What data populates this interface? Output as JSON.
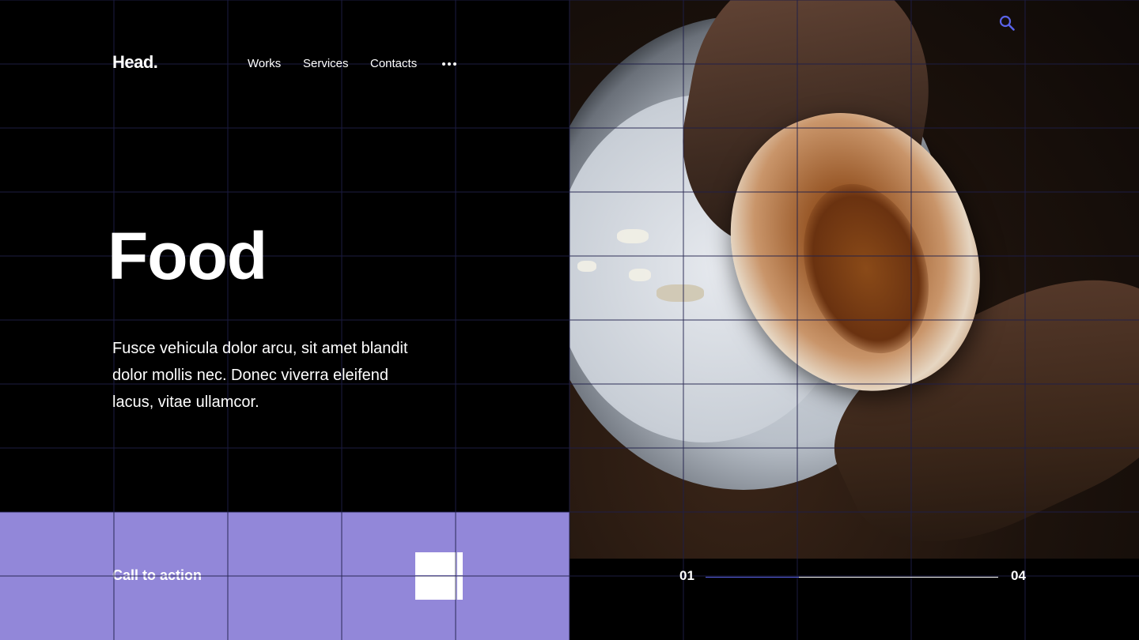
{
  "header": {
    "logo": "Head.",
    "nav": [
      "Works",
      "Services",
      "Contacts"
    ],
    "more_icon": "more-horizontal-icon",
    "search_icon": "search-icon"
  },
  "hero": {
    "title": "Food",
    "description": "Fusce vehicula dolor arcu, sit amet blandit dolor mollis nec. Donec viverra eleifend lacus, vitae ullamcor."
  },
  "cta": {
    "label": "Call to action",
    "button_icon": "grid-square-icon"
  },
  "pager": {
    "current": "01",
    "total": "04",
    "progress": 0.32
  },
  "colors": {
    "background": "#000000",
    "accent": "#9287d9",
    "search_icon": "#5a63e8",
    "text": "#ffffff",
    "grid_lines": "#1e1e4a"
  },
  "image": {
    "subject": "hands holding a sandwich over a white plate"
  }
}
